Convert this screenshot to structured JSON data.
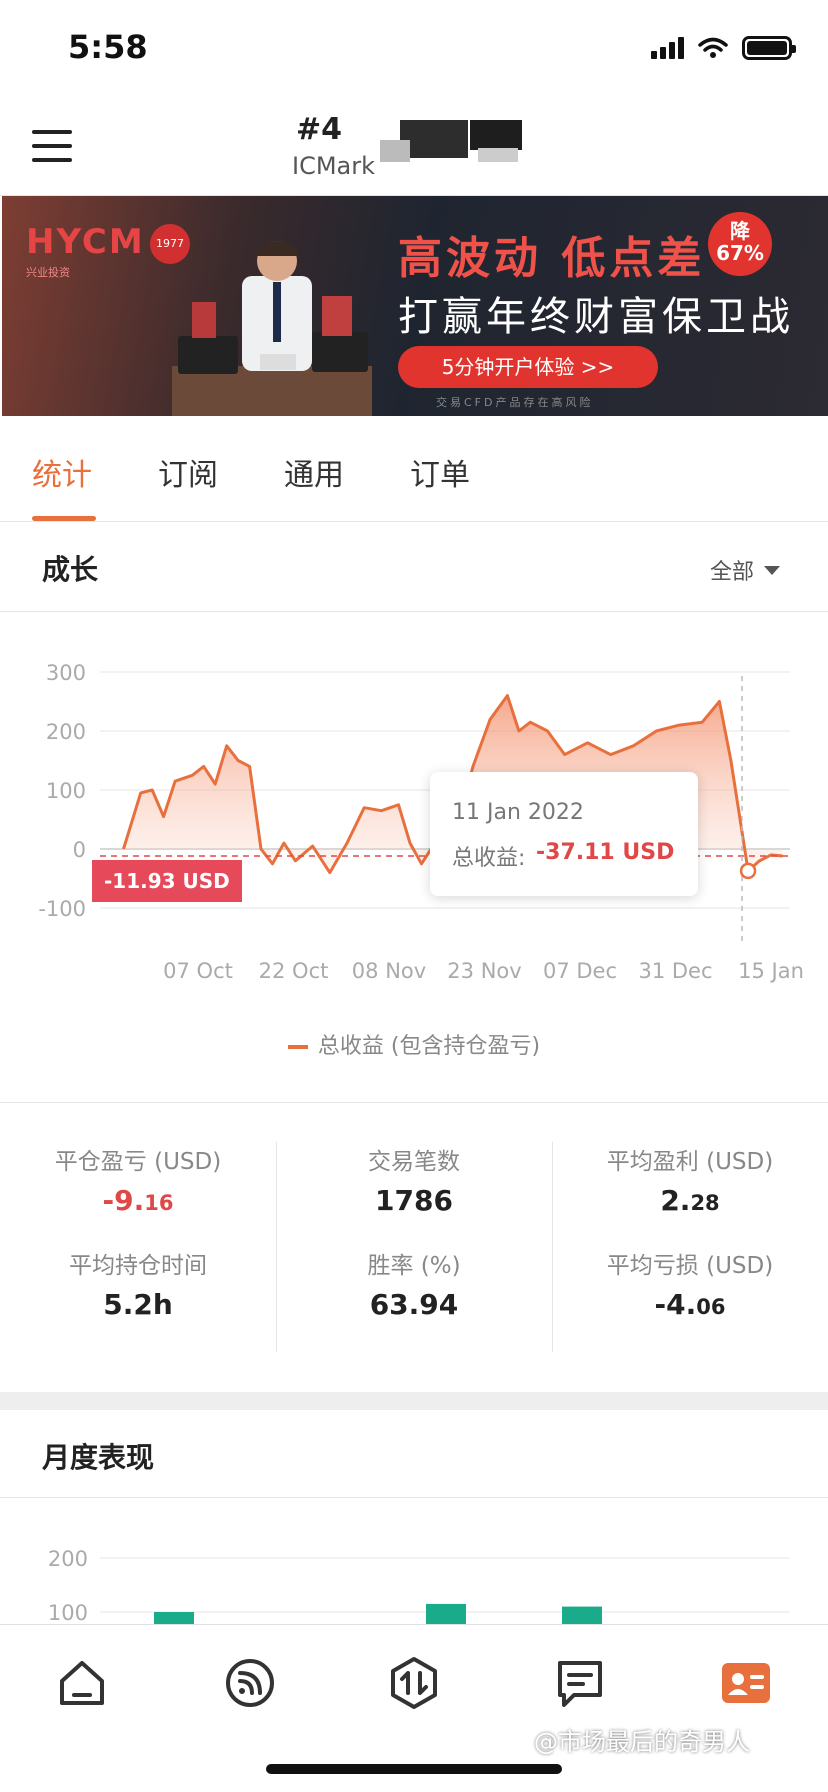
{
  "status_bar": {
    "time": "5:58"
  },
  "header": {
    "rank": "#4",
    "account": "ICMark"
  },
  "banner": {
    "logo": "HYCM",
    "logo_sub": "兴业投资",
    "seal": "1977",
    "title": "高波动 低点差",
    "subtitle": "打赢年终财富保卫战",
    "badge_top": "降",
    "badge_bottom": "67%",
    "cta": "5分钟开户体验 >>",
    "disclaimer": "交易CFD产品存在高风险"
  },
  "tabs": [
    {
      "label": "统计",
      "active": true
    },
    {
      "label": "订阅",
      "active": false
    },
    {
      "label": "通用",
      "active": false
    },
    {
      "label": "订单",
      "active": false
    }
  ],
  "growth": {
    "title": "成长",
    "filter": "全部"
  },
  "tooltip": {
    "date": "11 Jan 2022",
    "label": "总收益:",
    "value": "-37.11 USD"
  },
  "current_tag": "-11.93 USD",
  "chart_data": {
    "type": "area",
    "y_ticks": [
      "300",
      "200",
      "100",
      "0",
      "-100"
    ],
    "ylim": [
      -100,
      300
    ],
    "x_ticks": [
      "07 Oct",
      "22 Oct",
      "08 Nov",
      "23 Nov",
      "07 Dec",
      "31 Dec",
      "15 Jan"
    ],
    "series": [
      {
        "name": "总收益 (包含持仓盈亏)",
        "points": [
          [
            "24 Sep",
            0
          ],
          [
            "27 Sep",
            95
          ],
          [
            "29 Sep",
            100
          ],
          [
            "01 Oct",
            55
          ],
          [
            "03 Oct",
            115
          ],
          [
            "06 Oct",
            125
          ],
          [
            "08 Oct",
            140
          ],
          [
            "10 Oct",
            110
          ],
          [
            "12 Oct",
            175
          ],
          [
            "14 Oct",
            150
          ],
          [
            "16 Oct",
            140
          ],
          [
            "18 Oct",
            0
          ],
          [
            "20 Oct",
            -25
          ],
          [
            "22 Oct",
            10
          ],
          [
            "24 Oct",
            -20
          ],
          [
            "27 Oct",
            5
          ],
          [
            "30 Oct",
            -40
          ],
          [
            "02 Nov",
            10
          ],
          [
            "05 Nov",
            70
          ],
          [
            "08 Nov",
            65
          ],
          [
            "11 Nov",
            75
          ],
          [
            "13 Nov",
            10
          ],
          [
            "15 Nov",
            -25
          ],
          [
            "18 Nov",
            20
          ],
          [
            "21 Nov",
            30
          ],
          [
            "24 Nov",
            140
          ],
          [
            "27 Nov",
            220
          ],
          [
            "30 Nov",
            260
          ],
          [
            "02 Dec",
            200
          ],
          [
            "04 Dec",
            215
          ],
          [
            "07 Dec",
            200
          ],
          [
            "10 Dec",
            160
          ],
          [
            "14 Dec",
            180
          ],
          [
            "18 Dec",
            160
          ],
          [
            "22 Dec",
            175
          ],
          [
            "26 Dec",
            200
          ],
          [
            "30 Dec",
            210
          ],
          [
            "03 Jan",
            215
          ],
          [
            "06 Jan",
            250
          ],
          [
            "08 Jan",
            150
          ],
          [
            "11 Jan",
            -37.11
          ],
          [
            "13 Jan",
            -20
          ],
          [
            "15 Jan",
            -10
          ],
          [
            "17 Jan",
            -11.93
          ]
        ]
      }
    ],
    "reference_line": -11.93,
    "highlight_date": "11 Jan 2022",
    "grid": true,
    "legend_position": "bottom"
  },
  "stats": [
    {
      "label": "平仓盈亏 (USD)",
      "int": "-9.",
      "dec": "16",
      "negative": true
    },
    {
      "label": "交易笔数",
      "int": "1786",
      "dec": "",
      "negative": false
    },
    {
      "label": "平均盈利 (USD)",
      "int": "2.",
      "dec": "28",
      "negative": false
    },
    {
      "label": "平均持仓时间",
      "int": "5.2h",
      "dec": "",
      "negative": false
    },
    {
      "label": "胜率 (%)",
      "int": "63.94",
      "dec": "",
      "negative": false
    },
    {
      "label": "平均亏损 (USD)",
      "int": "-4.",
      "dec": "06",
      "negative": false
    }
  ],
  "monthly": {
    "title": "月度表现",
    "y_ticks": [
      "200",
      "100"
    ],
    "bar_values": [
      100,
      115,
      110
    ]
  },
  "bottom_nav": [
    "home-icon",
    "feed-icon",
    "trade-icon",
    "message-icon",
    "profile-icon"
  ],
  "watermark": "@市场最后的奇男人",
  "colors": {
    "accent": "#e8703d",
    "negative": "#e04848",
    "bar": "#1aab8a"
  }
}
